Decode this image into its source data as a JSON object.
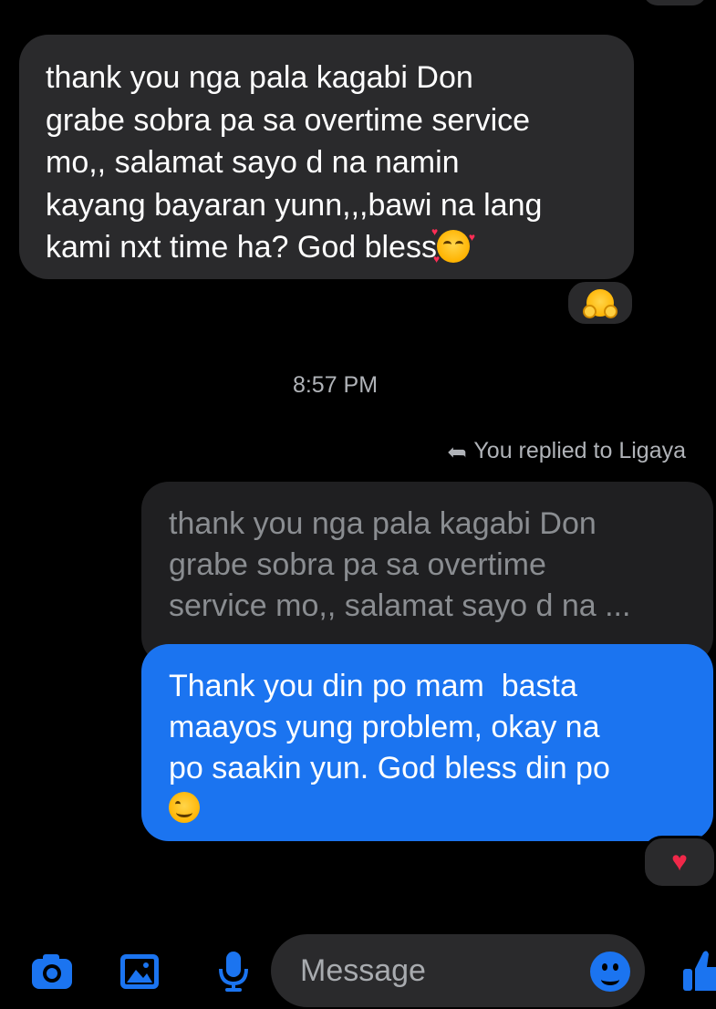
{
  "conversation": {
    "incoming_message": {
      "text": "thank you nga pala kagabi Don\ngrabe sobra pa sa overtime service\nmo,, salamat sayo d na namin\nkayang bayaran yunn,,,bawi na lang\nkami nxt time ha? God bless",
      "trailing_emoji": "smiling-face-with-hearts",
      "reaction": "hugging-face"
    },
    "timestamp": "8:57 PM",
    "reply_context": {
      "label": "You replied to Ligaya",
      "icon": "reply-arrow-icon"
    },
    "quoted_message": {
      "text": "thank you nga pala kagabi Don\ngrabe sobra pa sa overtime\nservice mo,, salamat sayo d na ..."
    },
    "outgoing_message": {
      "text": "Thank you din po mam  basta\nmaayos yung problem, okay na\npo saakin yun. God bless din po",
      "trailing_emoji": "smiling-face-with-smiling-eyes",
      "reaction": "red-heart",
      "bubble_color": "#1b74f0"
    }
  },
  "composer": {
    "placeholder": "Message",
    "icons": [
      "camera-icon",
      "image-icon",
      "microphone-icon",
      "emoji-icon",
      "thumbs-up-icon"
    ],
    "accent_color": "#1b74f0"
  }
}
